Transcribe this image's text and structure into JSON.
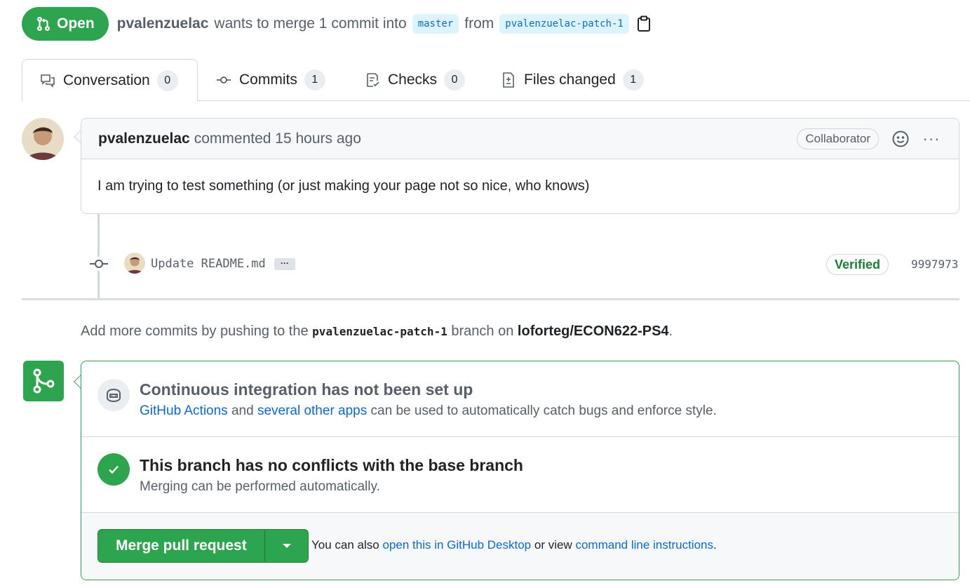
{
  "header": {
    "state_label": "Open",
    "author": "pvalenzuelac",
    "text_merge": "wants to merge 1 commit into",
    "base_branch": "master",
    "text_from": "from",
    "head_branch": "pvalenzuelac-patch-1",
    "copy_icon": "clipboard-icon"
  },
  "tabs": [
    {
      "label": "Conversation",
      "count": "0",
      "icon": "comment-discussion-icon",
      "selected": true
    },
    {
      "label": "Commits",
      "count": "1",
      "icon": "git-commit-icon",
      "selected": false
    },
    {
      "label": "Checks",
      "count": "0",
      "icon": "checklist-icon",
      "selected": false
    },
    {
      "label": "Files changed",
      "count": "1",
      "icon": "file-diff-icon",
      "selected": false
    }
  ],
  "comment": {
    "author": "pvalenzuelac",
    "meta": "commented 15 hours ago",
    "role": "Collaborator",
    "body": "I am trying to test something (or just making your page not so nice, who knows)",
    "more_label": "···"
  },
  "commit": {
    "message": "Update README.md",
    "expand_label": "···",
    "verified": "Verified",
    "sha": "9997973"
  },
  "push_hint": {
    "prefix": "Add more commits by pushing to the",
    "branch": "pvalenzuelac-patch-1",
    "middle": "branch on",
    "repo": "loforteg/ECON622-PS4",
    "suffix": "."
  },
  "merge_box": {
    "ci": {
      "title": "Continuous integration has not been set up",
      "link1": "GitHub Actions",
      "and": "and",
      "link2": "several other apps",
      "rest": "can be used to automatically catch bugs and enforce style."
    },
    "conflicts": {
      "title": "This branch has no conflicts with the base branch",
      "subtitle": "Merging can be performed automatically."
    },
    "actions": {
      "merge_label": "Merge pull request",
      "alt_prefix": "You can also",
      "alt_link1": "open this in GitHub Desktop",
      "alt_middle": "or view",
      "alt_link2": "command line instructions",
      "alt_suffix": "."
    }
  },
  "colors": {
    "open_green": "#2da44e",
    "link_blue": "#0969da",
    "verified_green": "#1a7f37"
  }
}
